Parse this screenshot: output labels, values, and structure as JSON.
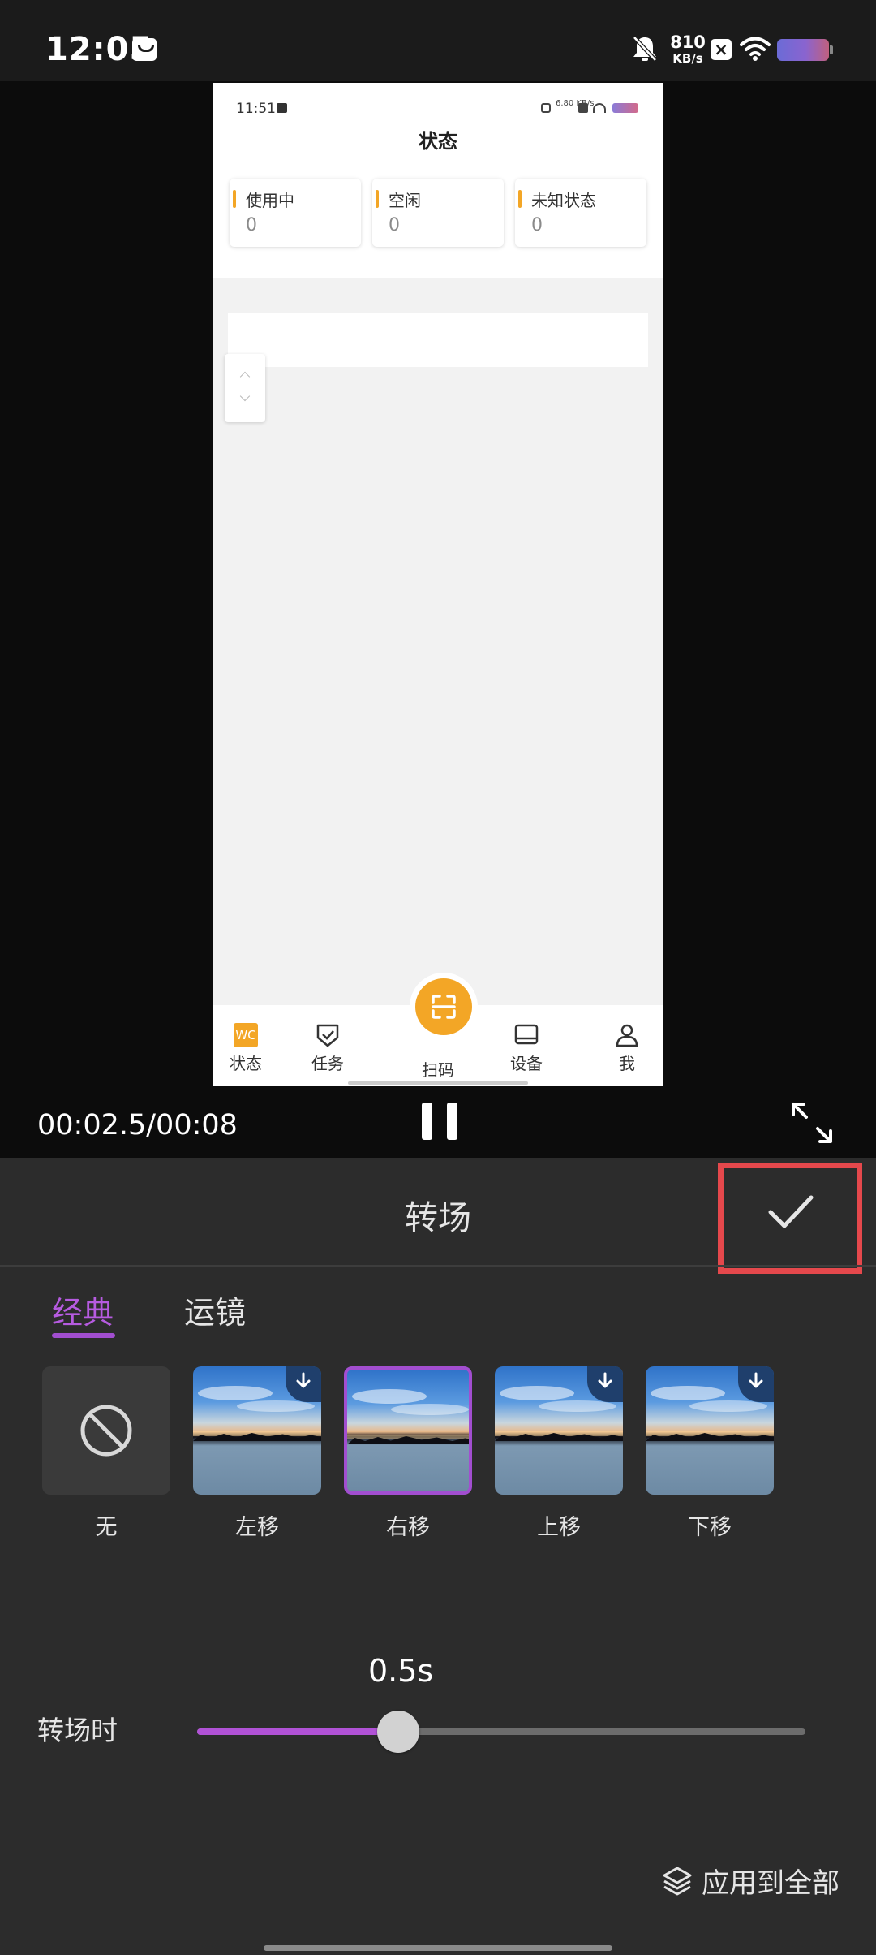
{
  "status_bar": {
    "time": "12:05",
    "net_speed_value": "810",
    "net_speed_unit": "KB/s",
    "icons": [
      "message-icon",
      "bell-off-icon",
      "x-app-icon",
      "wifi-icon",
      "battery-icon"
    ]
  },
  "preview": {
    "status_time": "11:51",
    "status_speed": "6.80 KB/s",
    "title": "状态",
    "cards": [
      {
        "label": "使用中",
        "value": "0"
      },
      {
        "label": "空闲",
        "value": "0"
      },
      {
        "label": "未知状态",
        "value": "0"
      }
    ],
    "nav": [
      {
        "label": "状态",
        "icon": "status-icon",
        "badge": "WC"
      },
      {
        "label": "任务",
        "icon": "task-shield-icon"
      },
      {
        "label": "扫码",
        "icon": "scan-icon"
      },
      {
        "label": "设备",
        "icon": "device-icon"
      },
      {
        "label": "我",
        "icon": "person-icon"
      }
    ],
    "accent_color": "#f3a626"
  },
  "playback": {
    "time": "00:02.5/00:08",
    "state": "playing"
  },
  "panel": {
    "title": "转场",
    "tabs": [
      {
        "label": "经典",
        "active": true
      },
      {
        "label": "运镜",
        "active": false
      }
    ],
    "transitions": [
      {
        "label": "无",
        "selected": false,
        "downloadable": false
      },
      {
        "label": "左移",
        "selected": false,
        "downloadable": true
      },
      {
        "label": "右移",
        "selected": true,
        "downloadable": false
      },
      {
        "label": "上移",
        "selected": false,
        "downloadable": true
      },
      {
        "label": "下移",
        "selected": false,
        "downloadable": true
      }
    ],
    "duration_label": "转场时",
    "duration_value": "0.5s",
    "duration_fraction": 0.33,
    "apply_all_label": "应用到全部",
    "accent_color": "#a24ed0",
    "highlight_color": "#e5484c"
  }
}
